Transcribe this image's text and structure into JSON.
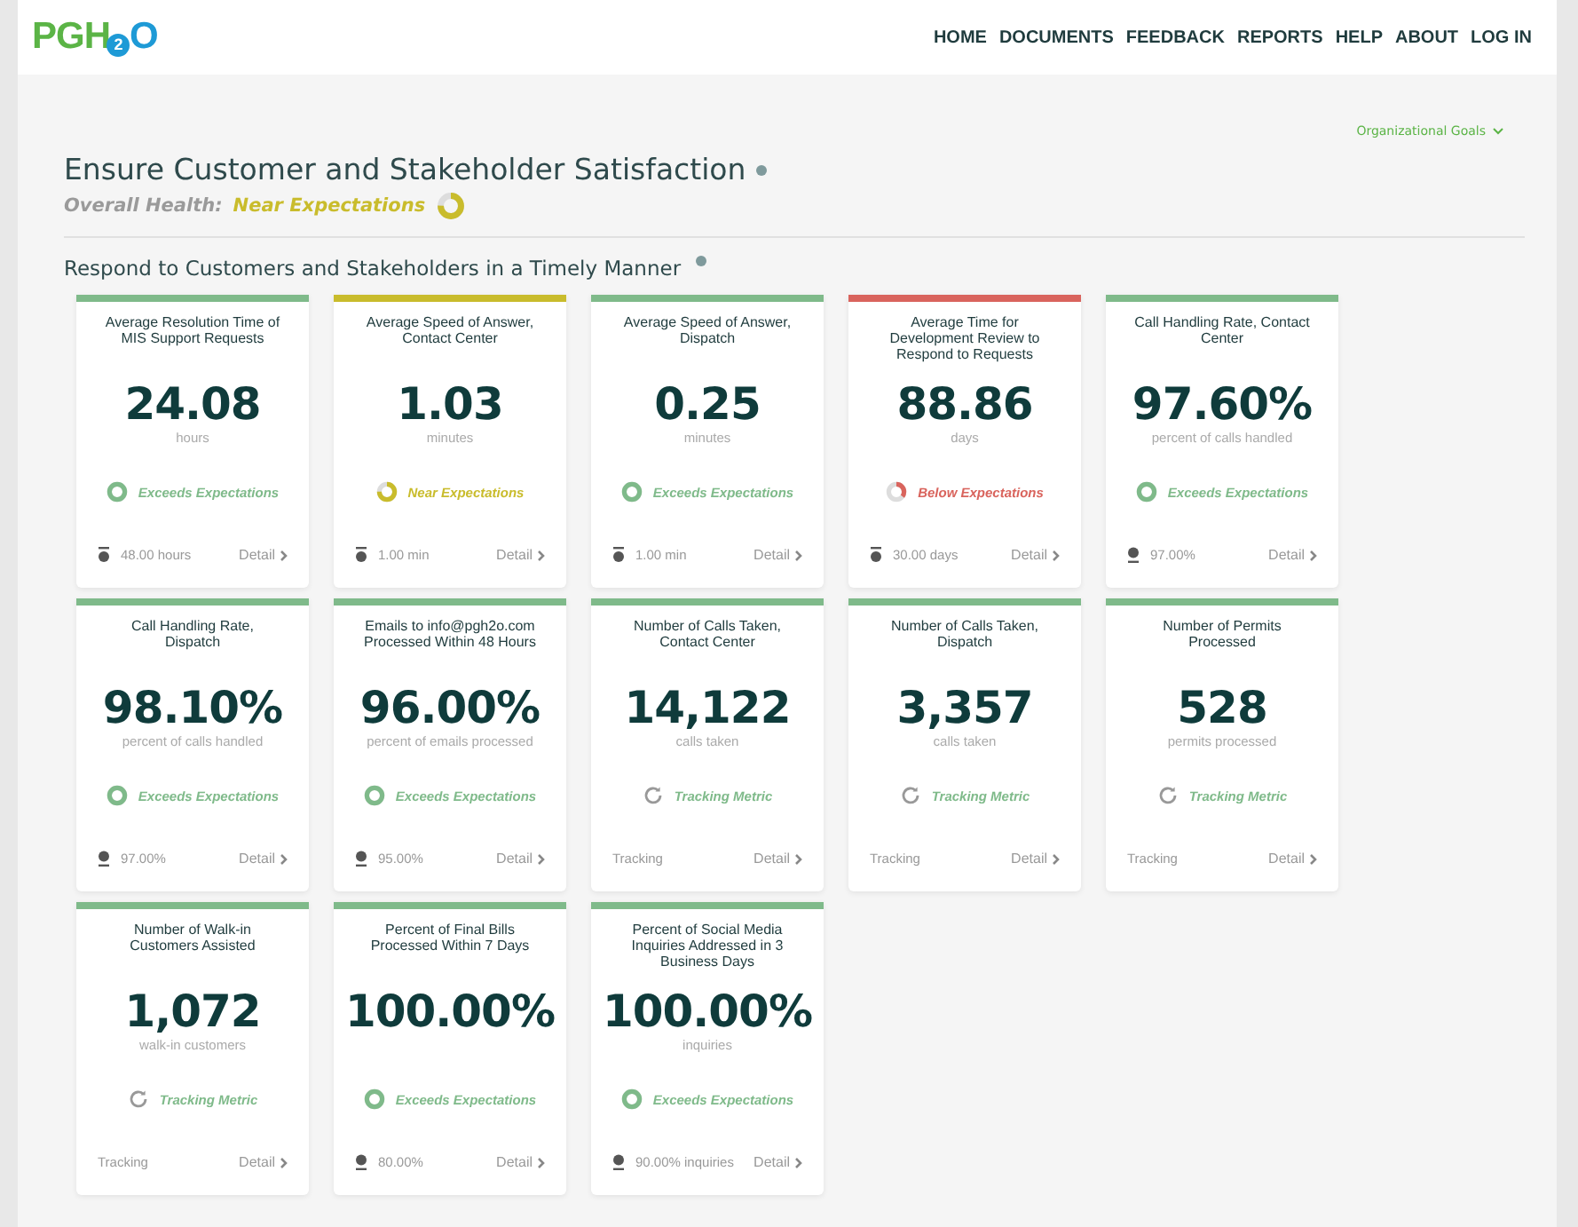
{
  "logo": {
    "lead": "PGH",
    "sub": "2",
    "tail": "O"
  },
  "nav": [
    "HOME",
    "DOCUMENTS",
    "FEEDBACK",
    "REPORTS",
    "HELP",
    "ABOUT",
    "LOG IN"
  ],
  "goals_menu": {
    "label": "Organizational Goals",
    "expanded": false
  },
  "goal": {
    "title": "Ensure Customer and Stakeholder Satisfaction",
    "health_label": "Overall Health:",
    "health": {
      "kind": "near",
      "text": "Near Expectations"
    }
  },
  "section": {
    "title": "Respond to Customers and Stakeholders in a Timely Manner"
  },
  "metrics": [
    {
      "title": "Average Resolution Time of MIS Support Requests",
      "value": "24.08",
      "unit": "hours",
      "status": {
        "kind": "exceeds",
        "text": "Exceeds Expectations"
      },
      "target": {
        "kind": "max",
        "text": "48.00 hours"
      },
      "link": "Detail"
    },
    {
      "title": "Average Speed of Answer, Contact Center",
      "value": "1.03",
      "unit": "minutes",
      "status": {
        "kind": "near",
        "text": "Near Expectations"
      },
      "target": {
        "kind": "max",
        "text": "1.00 min"
      },
      "link": "Detail"
    },
    {
      "title": "Average Speed of Answer, Dispatch",
      "value": "0.25",
      "unit": "minutes",
      "status": {
        "kind": "exceeds",
        "text": "Exceeds Expectations"
      },
      "target": {
        "kind": "max",
        "text": "1.00 min"
      },
      "link": "Detail"
    },
    {
      "title": "Average Time for Development Review to Respond to Requests",
      "value": "88.86",
      "unit": "days",
      "status": {
        "kind": "below",
        "text": "Below Expectations"
      },
      "target": {
        "kind": "max",
        "text": "30.00 days"
      },
      "link": "Detail"
    },
    {
      "title": "Call Handling Rate, Contact Center",
      "value": "97.60%",
      "unit": "percent of calls handled",
      "status": {
        "kind": "exceeds",
        "text": "Exceeds Expectations"
      },
      "target": {
        "kind": "min",
        "text": "97.00%"
      },
      "link": "Detail"
    },
    {
      "title": "Call Handling Rate, Dispatch",
      "value": "98.10%",
      "unit": "percent of calls handled",
      "status": {
        "kind": "exceeds",
        "text": "Exceeds Expectations"
      },
      "target": {
        "kind": "min",
        "text": "97.00%"
      },
      "link": "Detail"
    },
    {
      "title": "Emails to info@pgh2o.com Processed Within 48 Hours",
      "value": "96.00%",
      "unit": "percent of emails processed",
      "status": {
        "kind": "exceeds",
        "text": "Exceeds Expectations"
      },
      "target": {
        "kind": "min",
        "text": "95.00%"
      },
      "link": "Detail"
    },
    {
      "title": "Number of Calls Taken, Contact Center",
      "value": "14,122",
      "unit": "calls taken",
      "status": {
        "kind": "tracking",
        "text": "Tracking Metric"
      },
      "target": {
        "kind": "none",
        "text": "Tracking"
      },
      "link": "Detail"
    },
    {
      "title": "Number of Calls Taken, Dispatch",
      "value": "3,357",
      "unit": "calls taken",
      "status": {
        "kind": "tracking",
        "text": "Tracking Metric"
      },
      "target": {
        "kind": "none",
        "text": "Tracking"
      },
      "link": "Detail"
    },
    {
      "title": "Number of Permits Processed",
      "value": "528",
      "unit": "permits processed",
      "status": {
        "kind": "tracking",
        "text": "Tracking Metric"
      },
      "target": {
        "kind": "none",
        "text": "Tracking"
      },
      "link": "Detail"
    },
    {
      "title": "Number of Walk-in Customers Assisted",
      "value": "1,072",
      "unit": "walk-in customers",
      "status": {
        "kind": "tracking",
        "text": "Tracking Metric"
      },
      "target": {
        "kind": "none",
        "text": "Tracking"
      },
      "link": "Detail"
    },
    {
      "title": "Percent of Final Bills Processed Within 7 Days",
      "value": "100.00%",
      "status": {
        "kind": "exceeds",
        "text": "Exceeds Expectations"
      },
      "target": {
        "kind": "min",
        "text": "80.00%"
      },
      "link": "Detail"
    },
    {
      "title": "Percent of Social Media Inquiries Addressed in 3 Business Days",
      "value": "100.00%",
      "unit": "inquiries",
      "status": {
        "kind": "exceeds",
        "text": "Exceeds Expectations"
      },
      "target": {
        "kind": "min",
        "text": "90.00% inquiries"
      },
      "link": "Detail"
    }
  ]
}
